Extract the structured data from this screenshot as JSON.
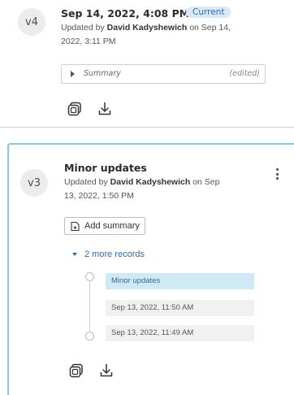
{
  "top_version": {
    "badge": "v4",
    "title": "Sep 14, 2022, 4:08 PM",
    "current_label": "Current",
    "updated_prefix": "Updated by",
    "author": "David Kadyshewich",
    "updated_on": "on Sep 14,",
    "updated_on_line2": "2022, 3:11 PM",
    "summary_label": "Summary",
    "summary_state": "(edited)"
  },
  "selected_version": {
    "badge": "v3",
    "title": "Minor updates",
    "updated_prefix": "Updated by",
    "author": "David Kadyshewich",
    "updated_on": "on Sep",
    "updated_on_line2": "13, 2022, 1:50 PM",
    "add_summary_label": "Add summary",
    "more_records_label": "2 more records",
    "records": [
      {
        "label": "Minor updates",
        "selected": true
      },
      {
        "label": "Sep 13, 2022, 11:50 AM",
        "selected": false
      },
      {
        "label": "Sep 13, 2022, 11:49 AM",
        "selected": false
      }
    ]
  },
  "icons": {
    "compare": "compare-icon",
    "download": "download-icon",
    "more": "more-vertical-icon",
    "add_summary": "add-note-icon"
  },
  "colors": {
    "accent": "#2e6cae",
    "selected_border": "#87c7e3",
    "selected_record_bg": "#cfe9f6",
    "current_pill_bg": "#dbe9f7"
  }
}
